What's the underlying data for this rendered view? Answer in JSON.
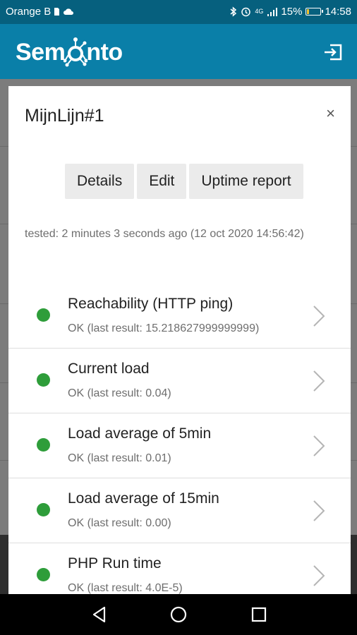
{
  "status_bar": {
    "carrier": "Orange B",
    "network": "4G",
    "battery": "15%",
    "battery_level": 0.15,
    "time": "14:58"
  },
  "app": {
    "logo_text_before": "Sem",
    "logo_text_after": "nto",
    "logout_icon": "logout-icon"
  },
  "dialog": {
    "title": "MijnLijn#1",
    "close_label": "×",
    "buttons": {
      "details": "Details",
      "edit": "Edit",
      "uptime": "Uptime report"
    },
    "tested": "tested: 2 minutes 3 seconds ago (12 oct 2020 14:56:42)",
    "checks": [
      {
        "title": "Reachability (HTTP ping)",
        "status": "OK (last result: 15.218627999999999)"
      },
      {
        "title": "Current load",
        "status": "OK (last result: 0.04)"
      },
      {
        "title": "Load average of 5min",
        "status": "OK (last result: 0.01)"
      },
      {
        "title": "Load average of 15min",
        "status": "OK (last result: 0.00)"
      },
      {
        "title": "PHP Run time",
        "status": "OK (last result: 4.0E-5)"
      }
    ]
  },
  "colors": {
    "header": "#0a7fa8",
    "status_bar": "#06607e",
    "ok_dot": "#2e9d3a"
  }
}
